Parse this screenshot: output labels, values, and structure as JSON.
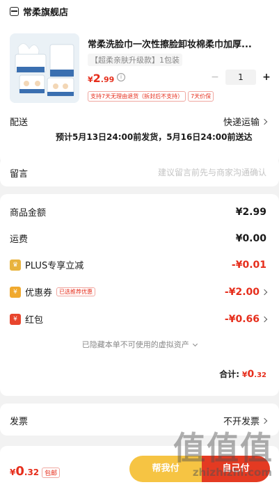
{
  "store": {
    "name": "常柔旗舰店"
  },
  "product": {
    "title": "常柔洗脸巾一次性擦脸卸妆棉柔巾加厚...",
    "spec": "【超柔亲肤升级款】1包装",
    "price_symbol": "¥",
    "price_int": "2",
    "price_dec": ".99",
    "quantity": "1",
    "minus": "−",
    "plus": "+",
    "tags": [
      "支持7天无理由退货（拆封后不支持）",
      "7天价保"
    ]
  },
  "shipping": {
    "label": "配送",
    "method": "快递运输",
    "estimate": "预计5月13日24:00前发货，5月16日24:00前送达"
  },
  "remark": {
    "label": "留言",
    "placeholder": "建议留言前先与商家沟通确认"
  },
  "amounts": {
    "goods_label": "商品金额",
    "goods_value": "¥2.99",
    "freight_label": "运费",
    "freight_value": "¥0.00",
    "plus_label": "PLUS专享立减",
    "plus_value": "-¥0.01",
    "coupon_label": "优惠券",
    "coupon_tag": "已选推荐优惠",
    "coupon_value": "-¥2.00",
    "redpacket_label": "红包",
    "redpacket_value": "-¥0.66",
    "hidden_assets": "已隐藏本单不可使用的虚拟资产",
    "total_label": "合计:",
    "total_symbol": "¥",
    "total_int": "0",
    "total_dec": ".32"
  },
  "invoice": {
    "label": "发票",
    "value": "不开发票"
  },
  "footer": {
    "price_symbol": "¥",
    "price_int": "0",
    "price_dec": ".32",
    "postage_tag": "包邮",
    "help_pay": "帮我付",
    "self_pay": "自己付"
  },
  "watermark": {
    "main": "值值值",
    "sub": "zhizhizhi.com"
  },
  "colors": {
    "accent": "#e62e1c",
    "help_button": "#f6c443",
    "pay_button": "#e43a22"
  }
}
